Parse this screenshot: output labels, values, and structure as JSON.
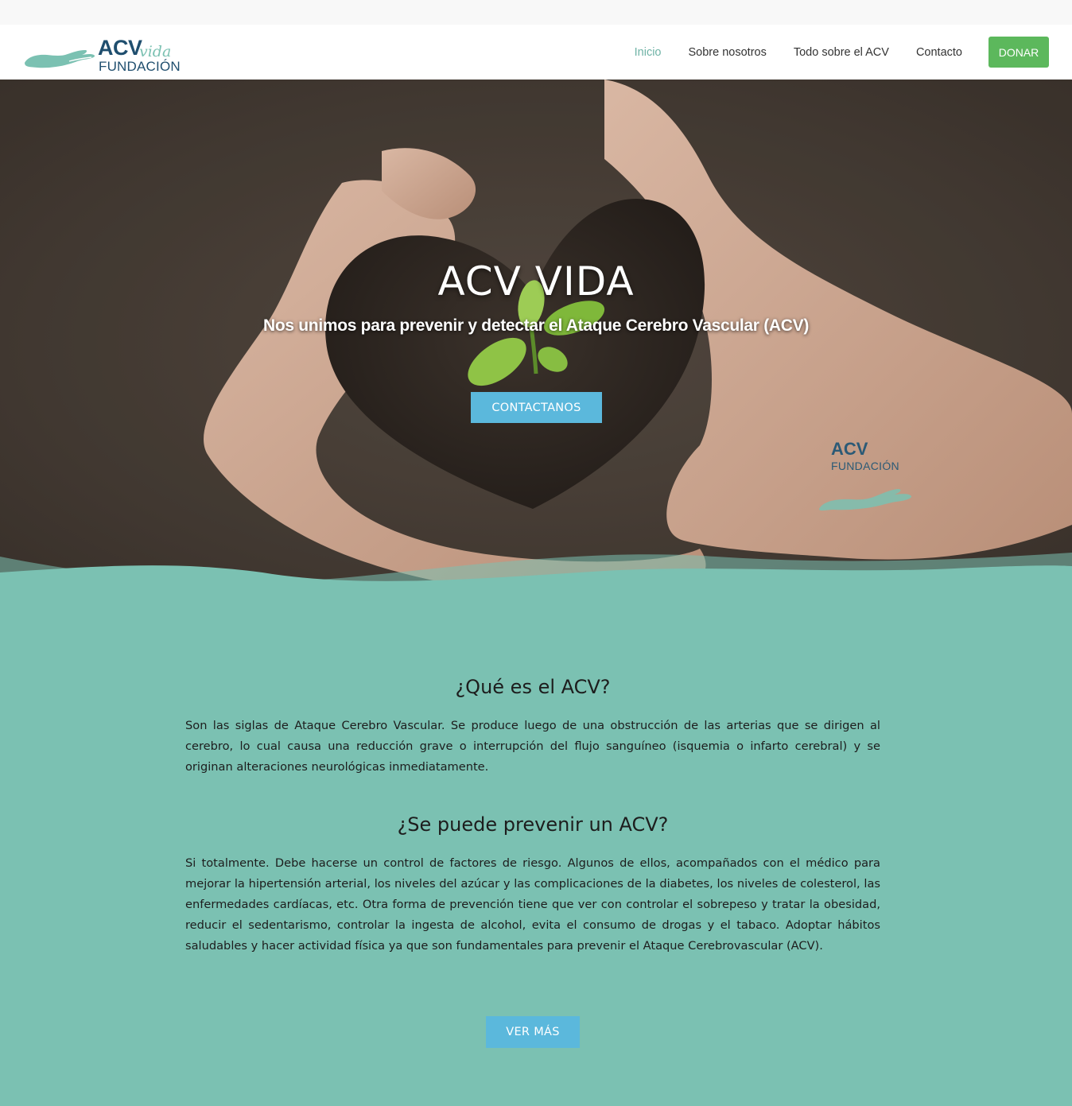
{
  "logo": {
    "acv": "ACV",
    "vida": "vida",
    "fundacion": "FUNDACIÓN"
  },
  "nav": {
    "items": [
      "Inicio",
      "Sobre nosotros",
      "Todo sobre el ACV",
      "Contacto"
    ],
    "donate": "DONAR"
  },
  "hero": {
    "title": "ACV VIDA",
    "subtitle": "Nos unimos para prevenir y detectar el Ataque Cerebro Vascular (ACV)",
    "button": "CONTACTANOS",
    "watermark_acv": "ACV",
    "watermark_fundacion": "FUNDACIÓN"
  },
  "section1": {
    "heading": "¿Qué es el ACV?",
    "body": "Son las siglas de Ataque Cerebro Vascular. Se produce luego de una obstrucción de las arterias que se dirigen al cerebro, lo cual causa una reducción grave o interrupción del flujo sanguíneo (isquemia o infarto cerebral) y se originan  alteraciones neurológicas inmediatamente."
  },
  "section2": {
    "heading": "¿Se puede prevenir un ACV?",
    "body": "Si totalmente. Debe hacerse un control de factores de riesgo. Algunos de ellos, acompañados con el médico para mejorar  la hipertensión arterial, los niveles del azúcar y las complicaciones de la diabetes, los niveles de colesterol, las enfermedades cardíacas, etc. Otra forma de prevención tiene que ver con controlar el  sobrepeso y tratar la obesidad, reducir el sedentarismo, controlar la ingesta de alcohol, evita el consumo de drogas y el tabaco.  Adoptar hábitos saludables y hacer actividad física ya que son fundamentales para prevenir el Ataque Cerebrovascular (ACV)."
  },
  "more_button": "VER MÁS",
  "colors": {
    "teal": "#7bc1b2",
    "brand_navy": "#1f4e6e",
    "button_blue": "#5bb8dc",
    "donate_green": "#5cb85c"
  }
}
